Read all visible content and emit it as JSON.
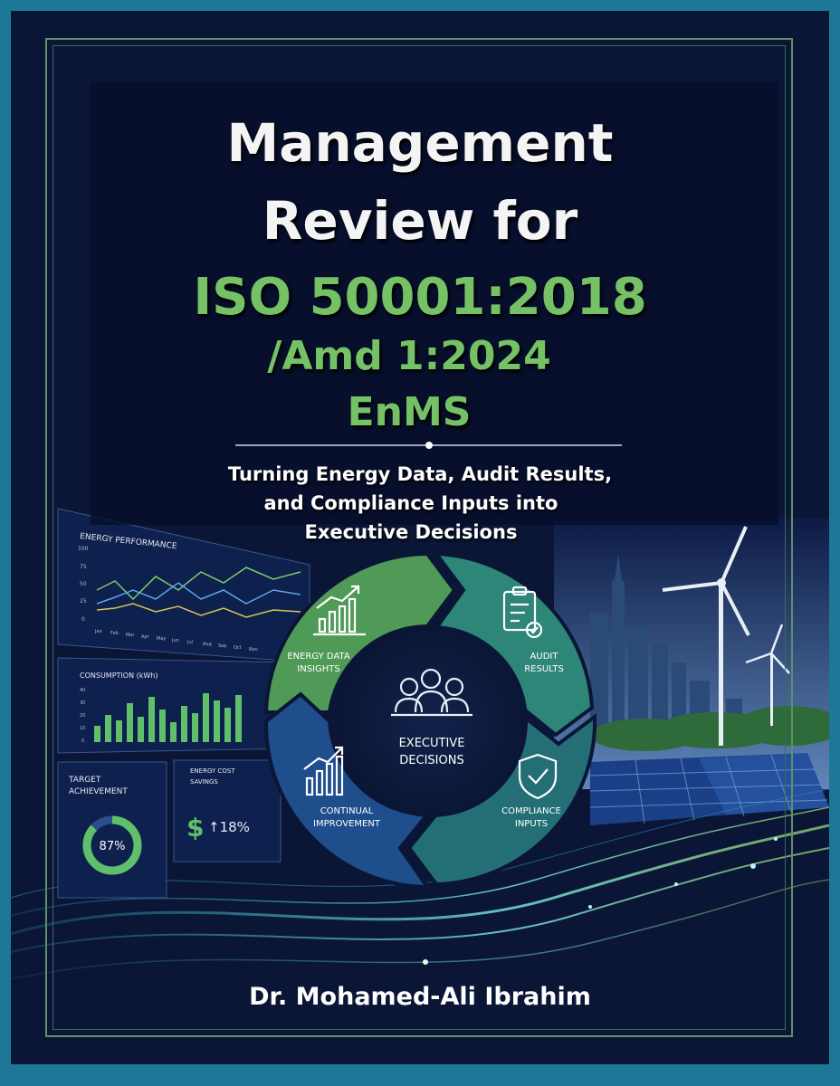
{
  "cover": {
    "title_line1": "Management",
    "title_line2": "Review for",
    "title_line3": "ISO 50001:2018",
    "title_line4": "/Amd 1:2024",
    "title_line5": "EnMS",
    "subtitle_line1": "Turning Energy Data, Audit Results,",
    "subtitle_line2": "and Compliance Inputs into",
    "subtitle_line3": "Executive Decisions",
    "author": "Dr. Mohamed-Ali Ibrahim"
  },
  "dashboard": {
    "perf_title": "ENERGY PERFORMANCE",
    "perf_ticks": [
      "100",
      "75",
      "50",
      "25",
      "0"
    ],
    "perf_months": [
      "Jan",
      "Feb",
      "Mar",
      "Apr",
      "May",
      "Jun",
      "Jul",
      "Aug",
      "Sep",
      "Oct",
      "Nov"
    ],
    "consumption_title": "CONSUMPTION (kWh)",
    "consumption_ticks": [
      "40",
      "30",
      "20",
      "10",
      "0"
    ],
    "target_title_1": "TARGET",
    "target_title_2": "ACHIEVEMENT",
    "target_value": "87%",
    "target_fraction": 0.87,
    "savings_title_1": "ENERGY COST",
    "savings_title_2": "SAVINGS",
    "savings_symbol": "$",
    "savings_value": "↑18%"
  },
  "cycle": {
    "center_line1": "EXECUTIVE",
    "center_line2": "DECISIONS",
    "seg_energy_1": "ENERGY DATA",
    "seg_energy_2": "INSIGHTS",
    "seg_audit_1": "AUDIT",
    "seg_audit_2": "RESULTS",
    "seg_compliance_1": "COMPLIANCE",
    "seg_compliance_2": "INPUTS",
    "seg_improve_1": "CONTINUAL",
    "seg_improve_2": "IMPROVEMENT"
  },
  "colors": {
    "background": "#0b1636",
    "border": "#1d7898",
    "accent_green": "#76c165",
    "segment_green": "#4f9a57",
    "segment_teal": "#2d8678",
    "segment_blue": "#1f4e8c"
  }
}
